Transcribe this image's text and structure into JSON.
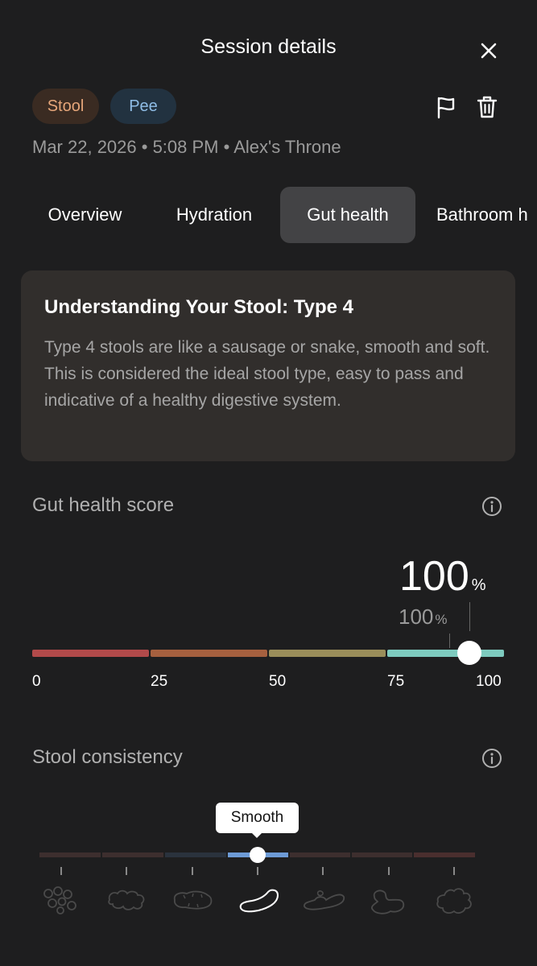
{
  "header": {
    "title": "Session details",
    "close_icon": "close-icon"
  },
  "tags": {
    "stool": "Stool",
    "pee": "Pee",
    "colors": {
      "stool_text": "#e6a67a",
      "stool_bg": "#3a2b22",
      "pee_text": "#8fbde6",
      "pee_bg": "#223240"
    }
  },
  "actions": {
    "flag_icon": "flag-icon",
    "delete_icon": "trash-icon"
  },
  "meta": "Mar 22, 2026 • 5:08 PM • Alex's Throne",
  "tabs": [
    {
      "label": "Overview",
      "active": false
    },
    {
      "label": "Hydration",
      "active": false
    },
    {
      "label": "Gut health",
      "active": true
    },
    {
      "label": "Bathroom h",
      "active": false
    }
  ],
  "info_card": {
    "title": "Understanding Your Stool: Type 4",
    "body": "Type 4 stools are like a sausage or snake, smooth and soft. This is considered the ideal stool type, easy to pass and indicative of a healthy digestive system."
  },
  "gut_health": {
    "title": "Gut health score",
    "score": "100",
    "score_unit": "%",
    "previous_score": "100",
    "previous_unit": "%",
    "value": 100,
    "scale": [
      "0",
      "25",
      "50",
      "75",
      "100"
    ],
    "segment_colors": [
      "#b24a4a",
      "#a6603f",
      "#9a8e5a",
      "#7ecbbf"
    ]
  },
  "stool_consistency": {
    "title": "Stool consistency",
    "selected_label": "Smooth",
    "selected_index": 3,
    "types": [
      "separate-lumps-icon",
      "lumpy-sausage-icon",
      "cracked-sausage-icon",
      "smooth-sausage-icon",
      "soft-blobs-icon",
      "mushy-icon",
      "watery-icon"
    ],
    "segment_colors": [
      "#3d2e2e",
      "#3d2e2e",
      "#2a323d",
      "#6d9bd6",
      "#3d2e2e",
      "#3d2e2e",
      "#4a2e2e"
    ]
  }
}
